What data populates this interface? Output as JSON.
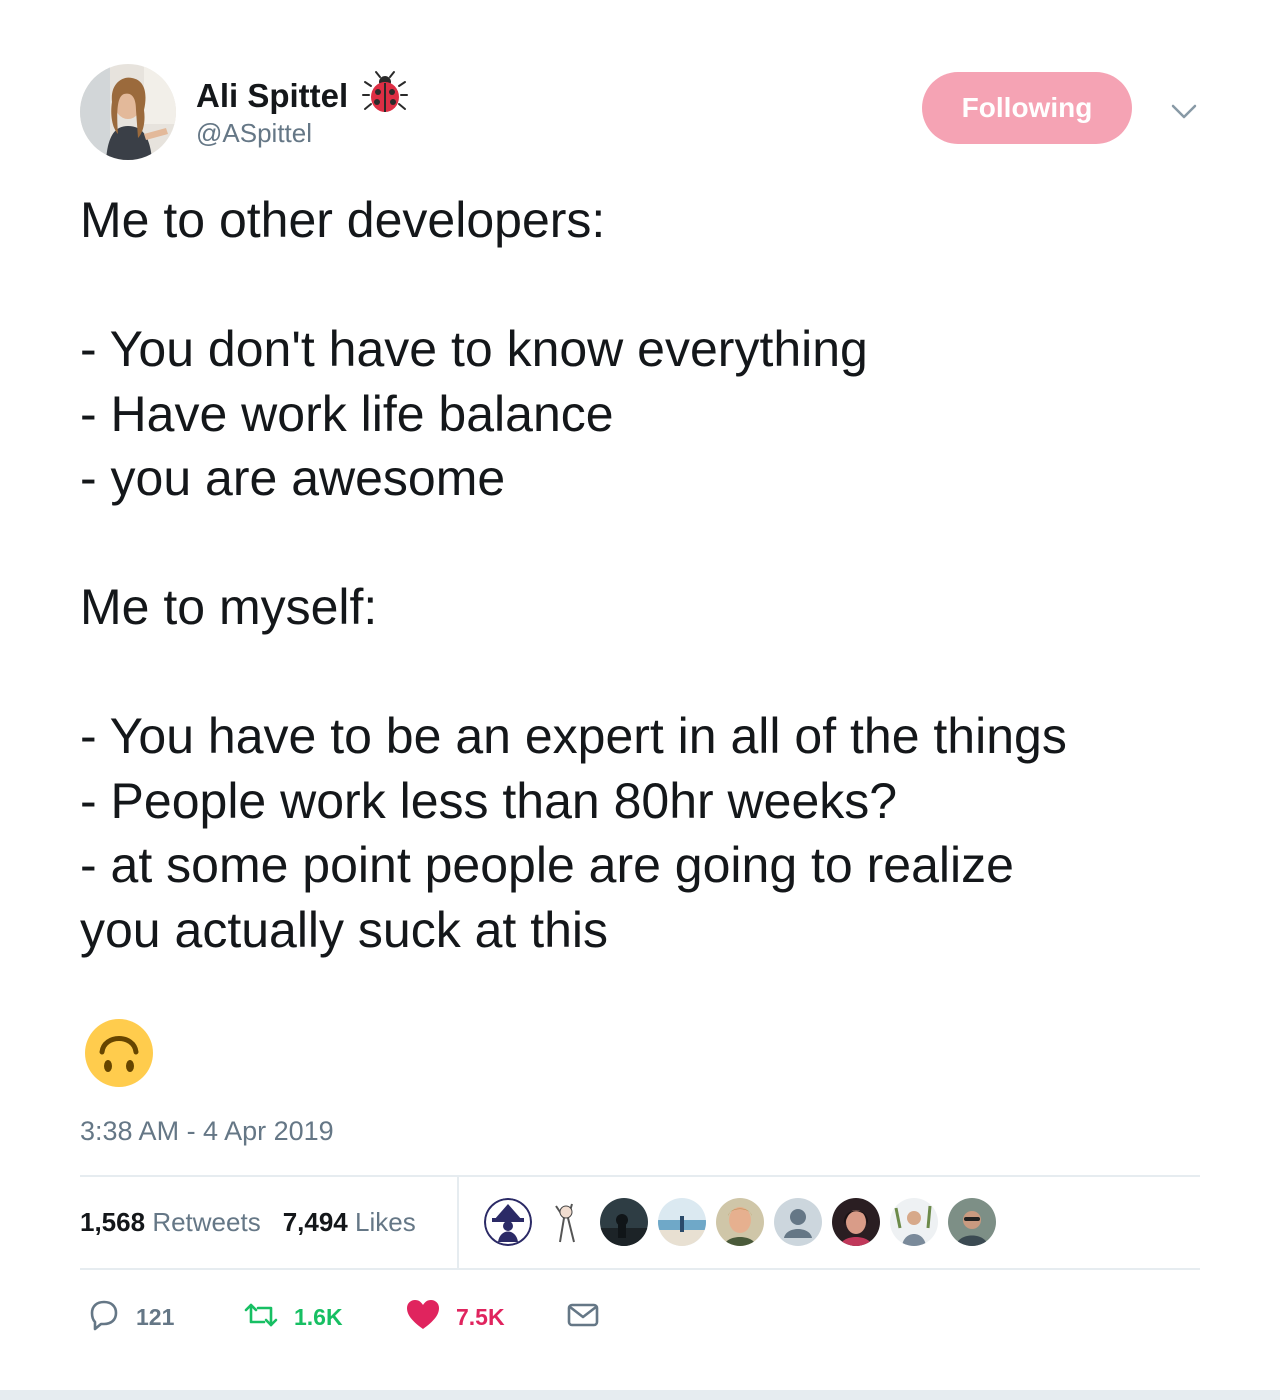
{
  "author": {
    "display_name": "Ali Spittel",
    "handle": "@ASpittel",
    "badge_icon": "ladybug-icon"
  },
  "follow_button": {
    "label": "Following",
    "color": "#f5a3b4"
  },
  "tweet": {
    "lines": [
      "Me to other developers:",
      "",
      "- You don't have to know everything",
      "- Have work life balance",
      "- you are awesome",
      "",
      "Me to myself:",
      "",
      "- You have to be an expert in all of the things",
      "- People work less than 80hr weeks?",
      "- at some point people are going to realize",
      "you actually suck at this"
    ],
    "emoji": "upside-down-face-emoji",
    "timestamp": "3:38 AM - 4 Apr 2019"
  },
  "stats": {
    "retweets_count": "1,568",
    "retweets_label": "Retweets",
    "likes_count": "7,494",
    "likes_label": "Likes"
  },
  "actions": {
    "reply_count": "121",
    "retweet_count": "1.6K",
    "like_count": "7.5K"
  },
  "colors": {
    "text": "#14171a",
    "secondary": "#657786",
    "retweet": "#17bf63",
    "like": "#e0245e",
    "divider": "#e6ecf0"
  }
}
